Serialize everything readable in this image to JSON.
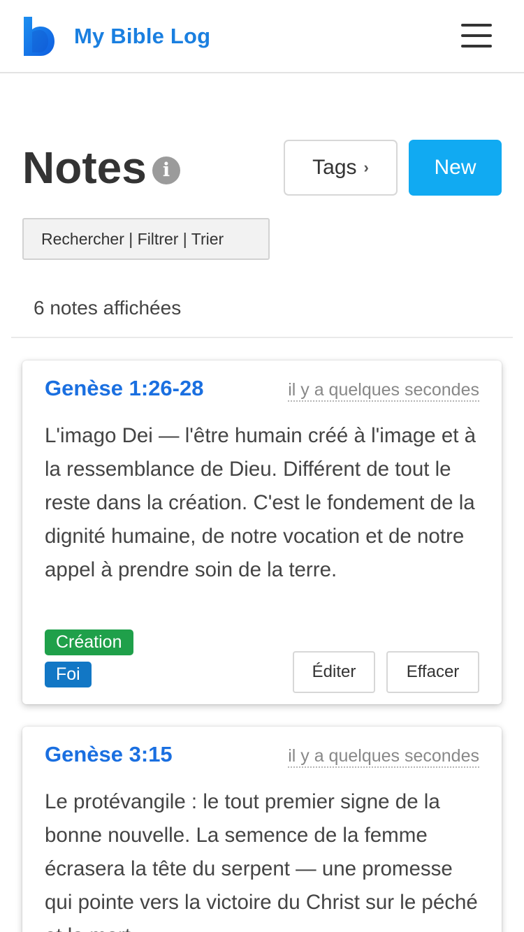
{
  "header": {
    "app_name": "My Bible Log",
    "logo_icon": "bible-log-logo",
    "menu_icon": "hamburger-menu-icon",
    "brand_color": "#1a7fe0"
  },
  "page": {
    "title": "Notes",
    "info_icon": "info-icon",
    "info_glyph": "i",
    "tags_button": "Tags",
    "tags_chevron": "›",
    "new_button": "New",
    "search_filter_sort": "Rechercher | Filtrer | Trier",
    "count_text": "6 notes affichées"
  },
  "notes": [
    {
      "reference": "Genèse 1:26-28",
      "time": "il y a quelques secondes",
      "text": "L'imago Dei — l'être humain créé à l'image et à la ressemblance de Dieu. Différent de tout le reste dans la création. C'est le fondement de la dignité humaine, de notre vocation et de notre appel à prendre soin de la terre.",
      "tags": [
        {
          "label": "Création",
          "color": "#1fa04a"
        },
        {
          "label": "Foi",
          "color": "#1277c5"
        }
      ],
      "edit_label": "Éditer",
      "delete_label": "Effacer"
    },
    {
      "reference": "Genèse 3:15",
      "time": "il y a quelques secondes",
      "text": "Le protévangile : le tout premier signe de la bonne nouvelle. La semence de la femme écrasera la tête du serpent — une promesse qui pointe vers la victoire du Christ sur le péché et la mort."
    }
  ],
  "colors": {
    "accent_button": "#11aaf2",
    "link": "#1a6fe0"
  }
}
